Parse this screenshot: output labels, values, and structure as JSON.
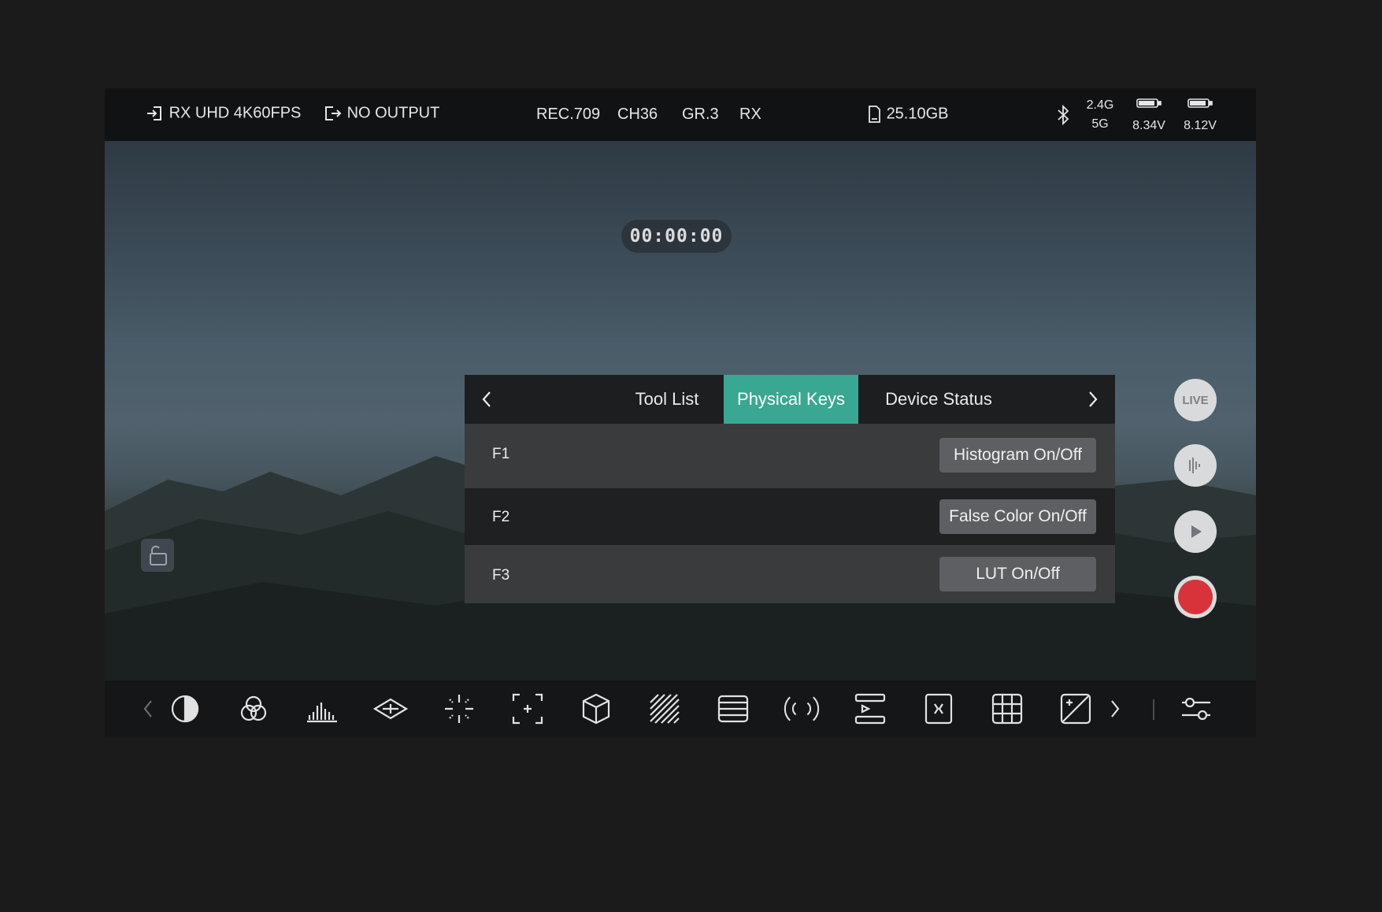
{
  "status_bar": {
    "input_label": "RX UHD 4K60FPS",
    "output_label": "NO OUTPUT",
    "color_space": "REC.709",
    "channel": "CH36",
    "group": "GR.3",
    "mode": "RX",
    "storage": "25.10GB",
    "band_top": "2.4G",
    "band_bottom": "5G",
    "battery_1": "8.34V",
    "battery_2": "8.12V"
  },
  "timecode": "00:00:00",
  "side_controls": {
    "live_label": "LIVE"
  },
  "dialog": {
    "tabs": [
      {
        "label": "Tool List",
        "active": false
      },
      {
        "label": "Physical Keys",
        "active": true
      },
      {
        "label": "Device Status",
        "active": false
      }
    ],
    "rows": [
      {
        "key": "F1",
        "function": "Histogram On/Off"
      },
      {
        "key": "F2",
        "function": "False Color On/Off"
      },
      {
        "key": "F3",
        "function": "LUT On/Off"
      }
    ]
  },
  "colors": {
    "accent": "#3aa792",
    "record": "#d8333a",
    "background": "#1b1b1c"
  },
  "toolbar_icons": [
    "chevron-left-icon",
    "contrast-icon",
    "rgb-circles-icon",
    "histogram-icon",
    "vectorscope-icon",
    "crosshair-icon",
    "focus-frame-icon",
    "cube-lut-icon",
    "zebra-icon",
    "waveform-icon",
    "audio-signal-icon",
    "timeline-icon",
    "anamorphic-icon",
    "grid-icon",
    "exposure-icon",
    "chevron-right-icon",
    "settings-sliders-icon"
  ]
}
